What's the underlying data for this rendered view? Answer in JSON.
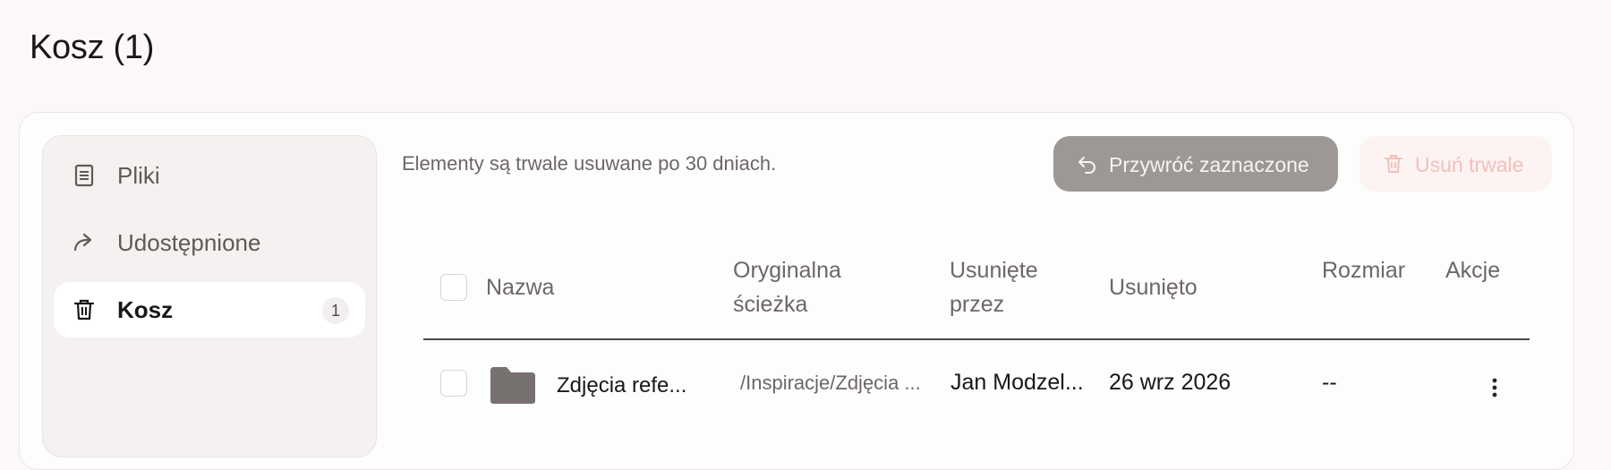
{
  "page": {
    "title": "Kosz (1)"
  },
  "sidebar": {
    "items": [
      {
        "label": "Pliki",
        "icon": "document-icon"
      },
      {
        "label": "Udostępnione",
        "icon": "share-arrow-icon"
      },
      {
        "label": "Kosz",
        "icon": "trash-icon",
        "count": "1",
        "active": true
      }
    ]
  },
  "toolbar": {
    "notice": "Elementy są trwale usuwane po 30 dniach.",
    "restore_label": "Przywróć zaznaczone",
    "delete_label": "Usuń trwale"
  },
  "table": {
    "headers": {
      "name": "Nazwa",
      "path_line1": "Oryginalna",
      "path_line2": "ścieżka",
      "deleted_by_line1": "Usunięte",
      "deleted_by_line2": "przez",
      "deleted_at": "Usunięto",
      "size": "Rozmiar",
      "actions": "Akcje"
    },
    "rows": [
      {
        "name": "Zdjęcia refe...",
        "path": "/Inspiracje/Zdjęcia ...",
        "deleted_by": "Jan Modzel...",
        "deleted_at": "26 wrz 2026",
        "size": "--"
      }
    ]
  },
  "colors": {
    "background": "#fbf8f7",
    "restore_button": "#9d9896",
    "delete_button_bg": "#fcf3f2",
    "delete_button_text": "#f1c0bb",
    "folder": "#77726f"
  }
}
